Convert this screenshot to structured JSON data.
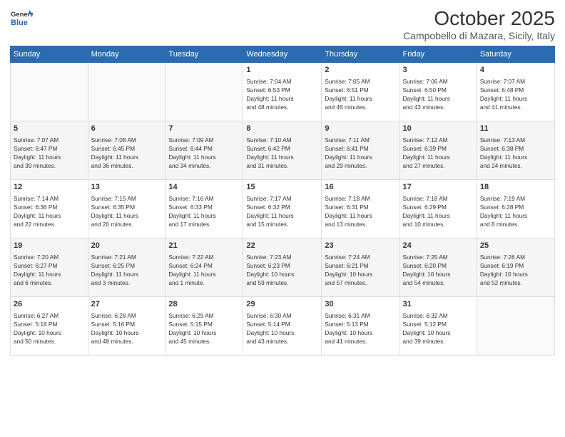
{
  "header": {
    "logo_line1": "General",
    "logo_line2": "Blue",
    "month": "October 2025",
    "location": "Campobello di Mazara, Sicily, Italy"
  },
  "weekdays": [
    "Sunday",
    "Monday",
    "Tuesday",
    "Wednesday",
    "Thursday",
    "Friday",
    "Saturday"
  ],
  "weeks": [
    {
      "days": [
        {
          "num": "",
          "info": ""
        },
        {
          "num": "",
          "info": ""
        },
        {
          "num": "",
          "info": ""
        },
        {
          "num": "1",
          "info": "Sunrise: 7:04 AM\nSunset: 6:53 PM\nDaylight: 11 hours\nand 48 minutes."
        },
        {
          "num": "2",
          "info": "Sunrise: 7:05 AM\nSunset: 6:51 PM\nDaylight: 11 hours\nand 46 minutes."
        },
        {
          "num": "3",
          "info": "Sunrise: 7:06 AM\nSunset: 6:50 PM\nDaylight: 11 hours\nand 43 minutes."
        },
        {
          "num": "4",
          "info": "Sunrise: 7:07 AM\nSunset: 6:48 PM\nDaylight: 11 hours\nand 41 minutes."
        }
      ]
    },
    {
      "days": [
        {
          "num": "5",
          "info": "Sunrise: 7:07 AM\nSunset: 6:47 PM\nDaylight: 11 hours\nand 39 minutes."
        },
        {
          "num": "6",
          "info": "Sunrise: 7:08 AM\nSunset: 6:45 PM\nDaylight: 11 hours\nand 36 minutes."
        },
        {
          "num": "7",
          "info": "Sunrise: 7:09 AM\nSunset: 6:44 PM\nDaylight: 11 hours\nand 34 minutes."
        },
        {
          "num": "8",
          "info": "Sunrise: 7:10 AM\nSunset: 6:42 PM\nDaylight: 11 hours\nand 31 minutes."
        },
        {
          "num": "9",
          "info": "Sunrise: 7:11 AM\nSunset: 6:41 PM\nDaylight: 11 hours\nand 29 minutes."
        },
        {
          "num": "10",
          "info": "Sunrise: 7:12 AM\nSunset: 6:39 PM\nDaylight: 11 hours\nand 27 minutes."
        },
        {
          "num": "11",
          "info": "Sunrise: 7:13 AM\nSunset: 6:38 PM\nDaylight: 11 hours\nand 24 minutes."
        }
      ]
    },
    {
      "days": [
        {
          "num": "12",
          "info": "Sunrise: 7:14 AM\nSunset: 6:36 PM\nDaylight: 11 hours\nand 22 minutes."
        },
        {
          "num": "13",
          "info": "Sunrise: 7:15 AM\nSunset: 6:35 PM\nDaylight: 11 hours\nand 20 minutes."
        },
        {
          "num": "14",
          "info": "Sunrise: 7:16 AM\nSunset: 6:33 PM\nDaylight: 11 hours\nand 17 minutes."
        },
        {
          "num": "15",
          "info": "Sunrise: 7:17 AM\nSunset: 6:32 PM\nDaylight: 11 hours\nand 15 minutes."
        },
        {
          "num": "16",
          "info": "Sunrise: 7:18 AM\nSunset: 6:31 PM\nDaylight: 11 hours\nand 13 minutes."
        },
        {
          "num": "17",
          "info": "Sunrise: 7:18 AM\nSunset: 6:29 PM\nDaylight: 11 hours\nand 10 minutes."
        },
        {
          "num": "18",
          "info": "Sunrise: 7:19 AM\nSunset: 6:28 PM\nDaylight: 11 hours\nand 8 minutes."
        }
      ]
    },
    {
      "days": [
        {
          "num": "19",
          "info": "Sunrise: 7:20 AM\nSunset: 6:27 PM\nDaylight: 11 hours\nand 6 minutes."
        },
        {
          "num": "20",
          "info": "Sunrise: 7:21 AM\nSunset: 6:25 PM\nDaylight: 11 hours\nand 3 minutes."
        },
        {
          "num": "21",
          "info": "Sunrise: 7:22 AM\nSunset: 6:24 PM\nDaylight: 11 hours\nand 1 minute."
        },
        {
          "num": "22",
          "info": "Sunrise: 7:23 AM\nSunset: 6:23 PM\nDaylight: 10 hours\nand 59 minutes."
        },
        {
          "num": "23",
          "info": "Sunrise: 7:24 AM\nSunset: 6:21 PM\nDaylight: 10 hours\nand 57 minutes."
        },
        {
          "num": "24",
          "info": "Sunrise: 7:25 AM\nSunset: 6:20 PM\nDaylight: 10 hours\nand 54 minutes."
        },
        {
          "num": "25",
          "info": "Sunrise: 7:26 AM\nSunset: 6:19 PM\nDaylight: 10 hours\nand 52 minutes."
        }
      ]
    },
    {
      "days": [
        {
          "num": "26",
          "info": "Sunrise: 6:27 AM\nSunset: 5:18 PM\nDaylight: 10 hours\nand 50 minutes."
        },
        {
          "num": "27",
          "info": "Sunrise: 6:28 AM\nSunset: 5:16 PM\nDaylight: 10 hours\nand 48 minutes."
        },
        {
          "num": "28",
          "info": "Sunrise: 6:29 AM\nSunset: 5:15 PM\nDaylight: 10 hours\nand 45 minutes."
        },
        {
          "num": "29",
          "info": "Sunrise: 6:30 AM\nSunset: 5:14 PM\nDaylight: 10 hours\nand 43 minutes."
        },
        {
          "num": "30",
          "info": "Sunrise: 6:31 AM\nSunset: 5:13 PM\nDaylight: 10 hours\nand 41 minutes."
        },
        {
          "num": "31",
          "info": "Sunrise: 6:32 AM\nSunset: 5:12 PM\nDaylight: 10 hours\nand 39 minutes."
        },
        {
          "num": "",
          "info": ""
        }
      ]
    }
  ]
}
